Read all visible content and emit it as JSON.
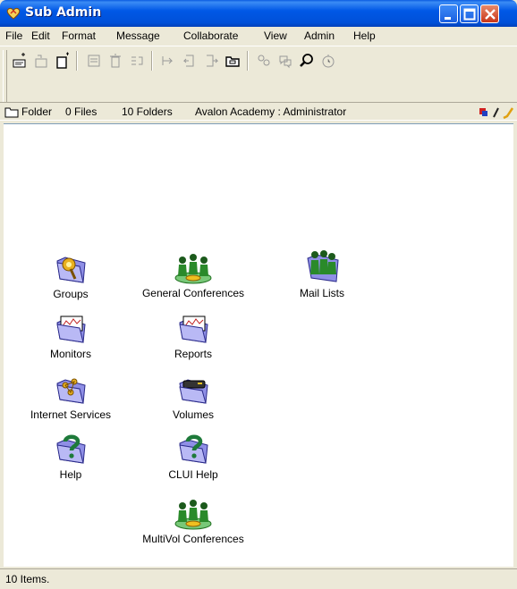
{
  "window": {
    "title": "Sub Admin"
  },
  "menu": [
    "File",
    "Edit",
    "Format",
    "Message",
    "Collaborate",
    "View",
    "Admin",
    "Help"
  ],
  "location": {
    "type": "Folder",
    "files": "0 Files",
    "folders": "10 Folders",
    "path": "Avalon Academy : Administrator"
  },
  "items": [
    {
      "label": "Groups",
      "icon": "groups-folder-icon"
    },
    {
      "label": "General Conferences",
      "icon": "conference-people-icon"
    },
    {
      "label": "Mail Lists",
      "icon": "mail-lists-people-icon"
    },
    {
      "label": "Monitors",
      "icon": "monitors-folder-icon"
    },
    {
      "label": "Reports",
      "icon": "reports-folder-icon"
    },
    {
      "label": "Internet Services",
      "icon": "internet-services-folder-icon"
    },
    {
      "label": "Volumes",
      "icon": "volumes-folder-icon"
    },
    {
      "label": "Help",
      "icon": "help-folder-icon"
    },
    {
      "label": "CLUI Help",
      "icon": "clui-help-folder-icon"
    },
    {
      "label": "MultiVol Conferences",
      "icon": "conference-people-icon"
    }
  ],
  "status": "10 Items."
}
